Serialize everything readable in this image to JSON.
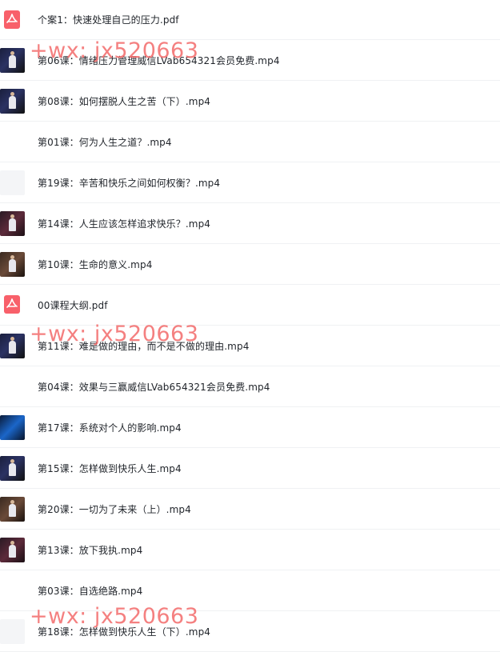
{
  "files": [
    {
      "name": "个案1：快速处理自己的压力.pdf",
      "type": "pdf",
      "thumb": "pdf-icon"
    },
    {
      "name": "第06课：情绪压力管理威信LVab654321会员免费.mp4",
      "type": "video",
      "thumb": "video-a"
    },
    {
      "name": "第08课：如何摆脱人生之苦（下）.mp4",
      "type": "video",
      "thumb": "video-a"
    },
    {
      "name": "第01课：何为人生之道？.mp4",
      "type": "video",
      "thumb": "blank"
    },
    {
      "name": "第19课：辛苦和快乐之间如何权衡？.mp4",
      "type": "video",
      "thumb": "light"
    },
    {
      "name": "第14课：人生应该怎样追求快乐？.mp4",
      "type": "video",
      "thumb": "video-b"
    },
    {
      "name": "第10课：生命的意义.mp4",
      "type": "video",
      "thumb": "video-d"
    },
    {
      "name": "00课程大纲.pdf",
      "type": "pdf",
      "thumb": "pdf-icon"
    },
    {
      "name": "第11课：难是做的理由，而不是不做的理由.mp4",
      "type": "video",
      "thumb": "video-a"
    },
    {
      "name": "第04课：效果与三赢威信LVab654321会员免费.mp4",
      "type": "video",
      "thumb": "blank"
    },
    {
      "name": "第17课：系统对个人的影响.mp4",
      "type": "video",
      "thumb": "video-c"
    },
    {
      "name": "第15课：怎样做到快乐人生.mp4",
      "type": "video",
      "thumb": "video-a"
    },
    {
      "name": "第20课：一切为了未来（上）.mp4",
      "type": "video",
      "thumb": "video-d"
    },
    {
      "name": "第13课：放下我执.mp4",
      "type": "video",
      "thumb": "video-b"
    },
    {
      "name": "第03课：自选绝路.mp4",
      "type": "video",
      "thumb": "blank"
    },
    {
      "name": "第18课：怎样做到快乐人生（下）.mp4",
      "type": "video",
      "thumb": "light"
    }
  ],
  "watermarks": [
    "+wx: jx520663",
    "+wx: jx520663",
    "+wx: jx520663"
  ],
  "colors": {
    "pdf_icon": "#f8606a",
    "watermark": "#f36a6a",
    "text": "#1f2329",
    "divider": "#f0f1f3"
  }
}
